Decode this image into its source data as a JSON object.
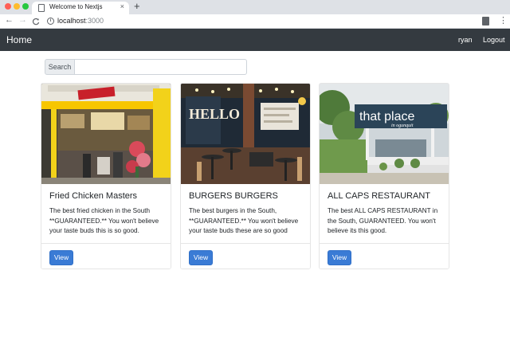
{
  "browser": {
    "tab_title": "Welcome to Nextjs",
    "tab_close": "×",
    "new_tab": "+",
    "back": "←",
    "forward": "→",
    "reload": "C",
    "info": "i",
    "url_host": "localhost",
    "url_port": ":3000",
    "menu": "⋮"
  },
  "navbar": {
    "brand": "Home",
    "user": "ryan",
    "logout": "Logout"
  },
  "search": {
    "label": "Search",
    "value": "",
    "placeholder": ""
  },
  "cards": [
    {
      "title": "Fried Chicken Masters",
      "text": "The best fried chicken in the South **GUARANTEED.** You won't believe your taste buds this is so good.",
      "button": "View"
    },
    {
      "title": "BURGERS BURGERS",
      "text": "The best burgers in the South, **GUARANTEED.** You won't believe your taste buds these are so good",
      "button": "View",
      "image_sign": "HELLO"
    },
    {
      "title": "ALL CAPS RESTAURANT",
      "text": "The best ALL CAPS RESTAURANT in the South, GUARANTEED. You won't believe its this good.",
      "button": "View",
      "image_sign": "that place",
      "image_sign_sub": "in ogunquit"
    }
  ],
  "colors": {
    "navbar_bg": "#343a40",
    "button_primary": "#3a7bd5"
  }
}
